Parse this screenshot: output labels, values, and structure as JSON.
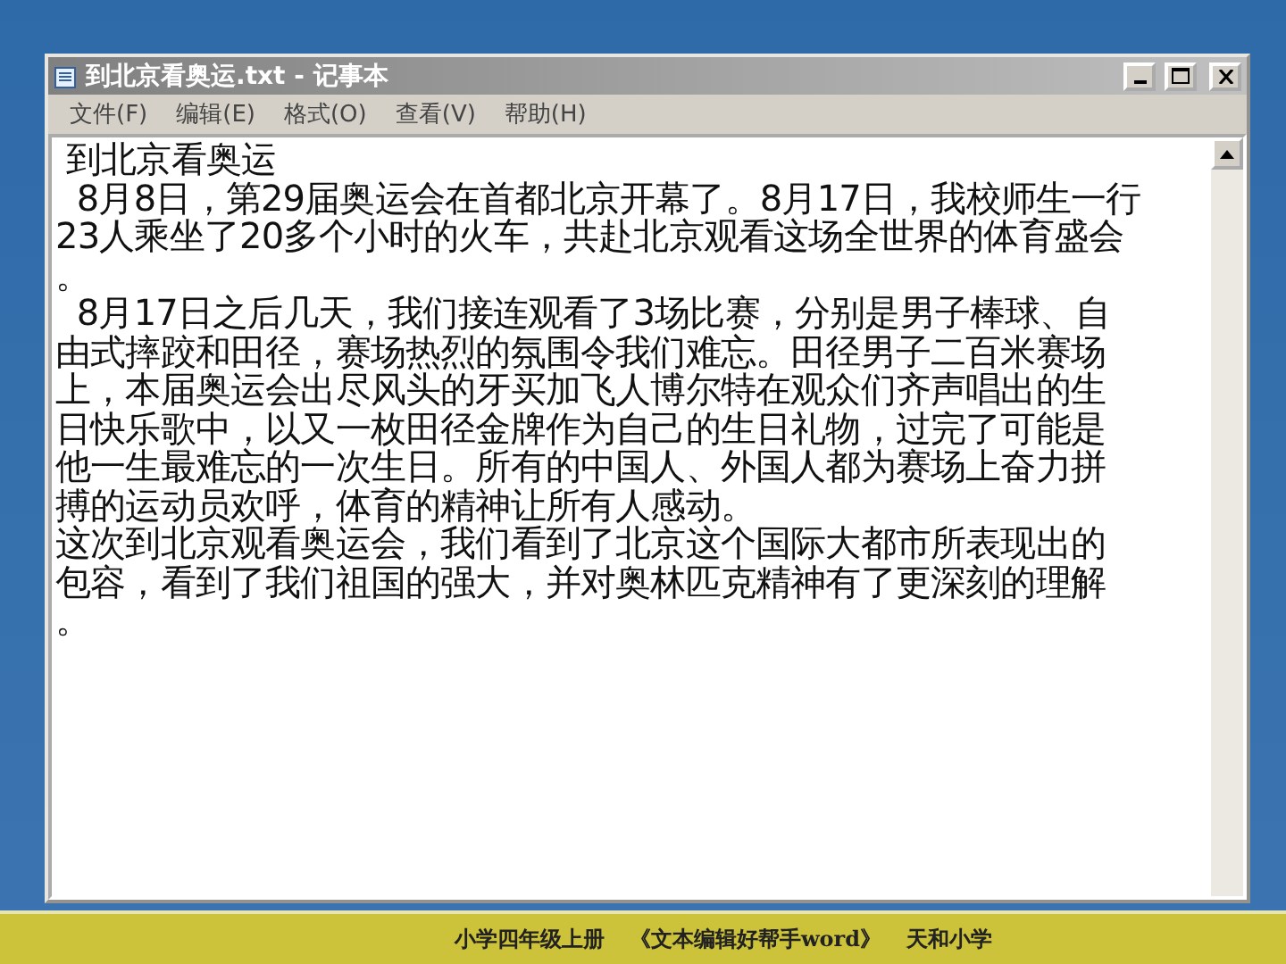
{
  "window": {
    "title": "到北京看奥运.txt - 记事本",
    "active": false
  },
  "menu": [
    "文件(F)",
    "编辑(E)",
    "格式(O)",
    "查看(V)",
    "帮助(H)"
  ],
  "document": {
    "lines": [
      " 到北京看奥运",
      "  8月8日，第29届奥运会在首都北京开幕了。8月17日，我校师生一行",
      "23人乘坐了20多个小时的火车，共赴北京观看这场全世界的体育盛会",
      "。",
      "  8月17日之后几天，我们接连观看了3场比赛，分别是男子棒球、自",
      "由式摔跤和田径，赛场热烈的氛围令我们难忘。田径男子二百米赛场",
      "上，本届奥运会出尽风头的牙买加飞人博尔特在观众们齐声唱出的生",
      "日快乐歌中，以又一枚田径金牌作为自己的生日礼物，过完了可能是",
      "他一生最难忘的一次生日。所有的中国人、外国人都为赛场上奋力拼",
      "搏的运动员欢呼，体育的精神让所有人感动。",
      "这次到北京观看奥运会，我们看到了北京这个国际大都市所表现出的",
      "包容，看到了我们祖国的强大，并对奥林匹克精神有了更深刻的理解",
      "。"
    ]
  },
  "footer": {
    "course": "小学四年级上册",
    "title": "《文本编辑好帮手word》",
    "school": "天和小学"
  }
}
